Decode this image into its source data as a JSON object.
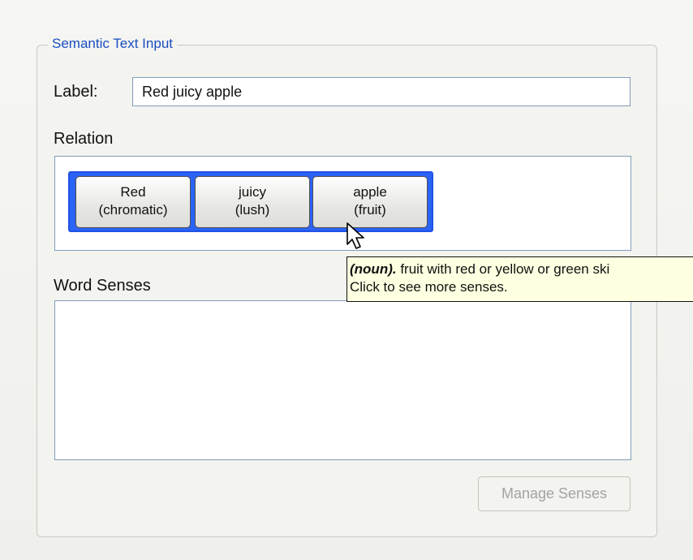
{
  "colors": {
    "group_title": "#1a4fc2",
    "selection_strip": "#2b63f5",
    "tooltip_background": "#ffffe1",
    "field_border": "#7f9db9"
  },
  "group": {
    "title": "Semantic Text Input"
  },
  "label_field": {
    "label": "Label:",
    "value": "Red juicy apple"
  },
  "relation": {
    "title": "Relation",
    "tokens": [
      {
        "word": "Red",
        "sense": "(chromatic)"
      },
      {
        "word": "juicy",
        "sense": "(lush)"
      },
      {
        "word": "apple",
        "sense": "(fruit)"
      }
    ]
  },
  "tooltip": {
    "pos": "(noun).",
    "gloss": " fruit with red or yellow or green ski",
    "hint": "Click to see more senses."
  },
  "word_senses": {
    "title": "Word Senses",
    "items": []
  },
  "buttons": {
    "manage_senses": "Manage Senses"
  },
  "icons": {
    "pointer": "mouse-pointer-icon"
  }
}
